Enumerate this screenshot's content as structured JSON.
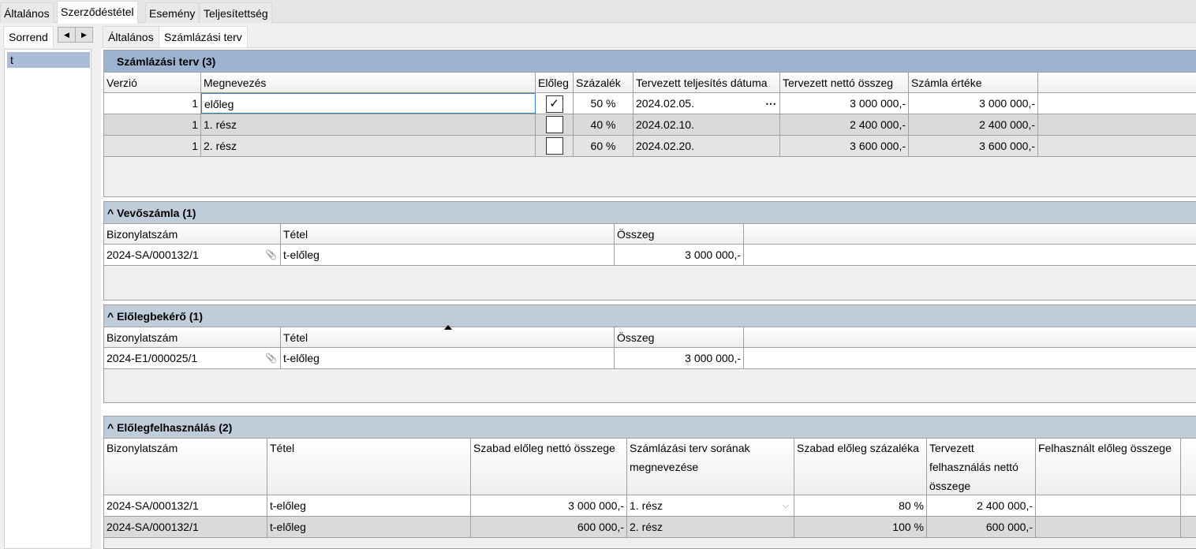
{
  "top_tabs": [
    "Általános",
    "Szerződéstétel",
    "Esemény",
    "Teljesítettség"
  ],
  "active_top_tab": "Szerződéstétel",
  "left_panel": {
    "tab": "Sorrend",
    "items": [
      "t"
    ]
  },
  "sub_tabs": [
    "Általános",
    "Számlázási terv"
  ],
  "colors": {
    "primary_header": "#9bb3cf",
    "section_header": "#bfcddb",
    "selected_row": "#a9bdd6",
    "alt_row": "#dadada"
  },
  "billing_plan": {
    "title": "Számlázási terv (3)",
    "columns": [
      "Verzió",
      "Megnevezés",
      "Előleg",
      "Százalék",
      "Tervezett teljesítés dátuma",
      "Tervezett nettó összeg",
      "Számla értéke",
      ""
    ],
    "rows": [
      [
        "1",
        "előleg",
        true,
        "50 %",
        "2024.02.05.",
        "3 000 000,-",
        "3 000 000,-",
        ""
      ],
      [
        "1",
        "1. rész",
        false,
        "40 %",
        "2024.02.10.",
        "2 400 000,-",
        "2 400 000,-",
        ""
      ],
      [
        "1",
        "2. rész",
        false,
        "60 %",
        "2024.02.20.",
        "3 600 000,-",
        "3 600 000,-",
        ""
      ]
    ],
    "ellipsis": "⋯"
  },
  "customer_invoice": {
    "title": "^ Vevőszámla (1)",
    "columns": [
      "Bizonylatszám",
      "Tétel",
      "Összeg",
      ""
    ],
    "rows": [
      [
        "2024-SA/000132/1",
        "t-előleg",
        "3 000 000,-",
        ""
      ]
    ]
  },
  "advance_request": {
    "title": "^ Előlegbekérő (1)",
    "columns": [
      "Bizonylatszám",
      "Tétel",
      "Összeg",
      ""
    ],
    "rows": [
      [
        "2024-E1/000025/1",
        "t-előleg",
        "3 000 000,-",
        ""
      ]
    ]
  },
  "advance_usage": {
    "title": "^ Előlegfelhasználás (2)",
    "columns": [
      "Bizonylatszám",
      "Tétel",
      "Szabad előleg nettó összege",
      "Számlázási terv sorának megnevezése",
      "Szabad előleg százaléka",
      "Tervezett felhasználás nettó összege",
      "Felhasznált előleg összege",
      ""
    ],
    "rows": [
      [
        "2024-SA/000132/1",
        "t-előleg",
        "3 000 000,-",
        "1. rész",
        "80 %",
        "2 400 000,-",
        "",
        ""
      ],
      [
        "2024-SA/000132/1",
        "t-előleg",
        "600 000,-",
        "2. rész",
        "100 %",
        "600 000,-",
        "",
        ""
      ]
    ]
  }
}
